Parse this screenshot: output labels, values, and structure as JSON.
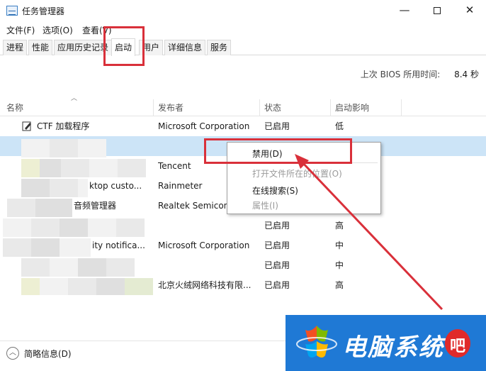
{
  "window": {
    "title": "任务管理器",
    "minimize": "—",
    "close": "✕"
  },
  "menu": [
    "文件(F)",
    "选项(O)",
    "查看(V)"
  ],
  "tabs": [
    "进程",
    "性能",
    "应用历史记录",
    "启动",
    "用户",
    "详细信息",
    "服务"
  ],
  "active_tab": "启动",
  "bios": {
    "label": "上次 BIOS 所用时间:",
    "value": "8.4 秒"
  },
  "columns": [
    "名称",
    "发布者",
    "状态",
    "启动影响"
  ],
  "rows": [
    {
      "name": "CTF 加载程序",
      "publisher": "Microsoft Corporation",
      "status": "已启用",
      "impact": "低"
    },
    {
      "name": "",
      "publisher": "",
      "status": "",
      "impact": ""
    },
    {
      "name": "",
      "publisher": "Tencent",
      "status": "",
      "impact": ""
    },
    {
      "name": "ktop custo...",
      "publisher": "Rainmeter",
      "status": "",
      "impact": ""
    },
    {
      "name": "音频管理器",
      "publisher": "Realtek Semicon",
      "status": "",
      "impact": ""
    },
    {
      "name": "",
      "publisher": "",
      "status": "已启用",
      "impact": "高"
    },
    {
      "name": "ity notifica...",
      "publisher": "Microsoft Corporation",
      "status": "已启用",
      "impact": "中"
    },
    {
      "name": "",
      "publisher": "",
      "status": "已启用",
      "impact": "中"
    },
    {
      "name": "",
      "publisher": "北京火绒网络科技有限...",
      "status": "已启用",
      "impact": "高"
    }
  ],
  "context_menu": {
    "disable": "禁用(D)",
    "open_location": "打开文件所在的位置(O)",
    "search_online": "在线搜索(S)",
    "properties": "属性(I)"
  },
  "footer": {
    "label": "简略信息(D)"
  },
  "watermark": {
    "text": "电脑系统",
    "badge": "吧"
  },
  "colors": {
    "selection": "#cce4f7",
    "annotation": "#d9303a",
    "watermark_bg": "#1f79d5"
  }
}
